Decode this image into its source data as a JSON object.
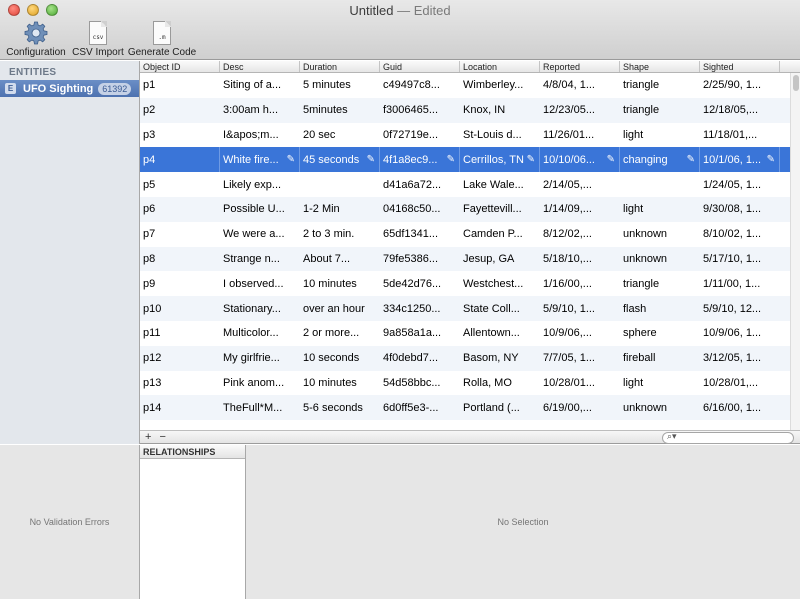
{
  "window": {
    "title": "Untitled",
    "edited": "— Edited"
  },
  "toolbar": {
    "configuration_label": "Configuration",
    "csv_import_label": "CSV Import",
    "generate_code_label": "Generate Code",
    "csv_tag": "csv",
    "m_tag": ".m"
  },
  "sidebar": {
    "header": "ENTITIES",
    "entity": {
      "badge": "E",
      "name": "UFO Sighting",
      "count": "61392"
    }
  },
  "table": {
    "columns": [
      "Object ID",
      "Desc",
      "Duration",
      "Guid",
      "Location",
      "Reported",
      "Shape",
      "Sighted"
    ],
    "rows": [
      [
        "p1",
        "Siting of a...",
        "5 minutes",
        "c49497c8...",
        "Wimberley...",
        "4/8/04, 1...",
        "triangle",
        "2/25/90, 1..."
      ],
      [
        "p2",
        "3:00am h...",
        "5minutes",
        "f3006465...",
        "Knox, IN",
        "12/23/05...",
        "triangle",
        "12/18/05,..."
      ],
      [
        "p3",
        "I&apos;m...",
        "20 sec",
        "0f72719e...",
        "St-Louis d...",
        "11/26/01...",
        "light",
        "11/18/01,..."
      ],
      [
        "p4",
        "White fire...",
        "45 seconds",
        "4f1a8ec9...",
        "Cerrillos, TN",
        "10/10/06...",
        "changing",
        "10/1/06, 1..."
      ],
      [
        "p5",
        "Likely exp...",
        "",
        "d41a6a72...",
        "Lake Wale...",
        "2/14/05,...",
        "",
        "1/24/05, 1..."
      ],
      [
        "p6",
        "Possible U...",
        "1-2 Min",
        "04168c50...",
        "Fayettevill...",
        "1/14/09,...",
        "light",
        "9/30/08, 1..."
      ],
      [
        "p7",
        "We were a...",
        "2 to 3 min.",
        "65df1341...",
        "Camden P...",
        "8/12/02,...",
        "unknown",
        "8/10/02, 1..."
      ],
      [
        "p8",
        "Strange n...",
        "About 7...",
        "79fe5386...",
        "Jesup, GA",
        "5/18/10,...",
        "unknown",
        "5/17/10, 1..."
      ],
      [
        "p9",
        "I observed...",
        "10 minutes",
        "5de42d76...",
        "Westchest...",
        "1/16/00,...",
        "triangle",
        "1/11/00, 1..."
      ],
      [
        "p10",
        "Stationary...",
        "over an hour",
        "334c1250...",
        "State Coll...",
        "5/9/10, 1...",
        "flash",
        "5/9/10, 12..."
      ],
      [
        "p11",
        "Multicolor...",
        "2 or more...",
        "9a858a1a...",
        "Allentown...",
        "10/9/06,...",
        "sphere",
        "10/9/06, 1..."
      ],
      [
        "p12",
        "My girlfrie...",
        "10 seconds",
        "4f0debd7...",
        "Basom, NY",
        "7/7/05, 1...",
        "fireball",
        "3/12/05, 1..."
      ],
      [
        "p13",
        "Pink anom...",
        "10 minutes",
        "54d58bbc...",
        "Rolla, MO",
        "10/28/01...",
        "light",
        "10/28/01,..."
      ],
      [
        "p14",
        "TheFull*M...",
        "5-6 seconds",
        "6d0ff5e3-...",
        "Portland (...",
        "6/19/00,...",
        "unknown",
        "6/16/00, 1..."
      ]
    ],
    "selected_row_index": 3
  },
  "footer": {
    "add_label": "+",
    "remove_label": "−",
    "search_placeholder": ""
  },
  "bottom": {
    "validation_text": "No Validation Errors",
    "relationships_header": "RELATIONSHIPS",
    "no_selection_text": "No Selection"
  },
  "colors": {
    "selection": "#3a75d8",
    "sidebar_bg": "#e3e7ec",
    "alt_row": "#f1f5fa"
  }
}
